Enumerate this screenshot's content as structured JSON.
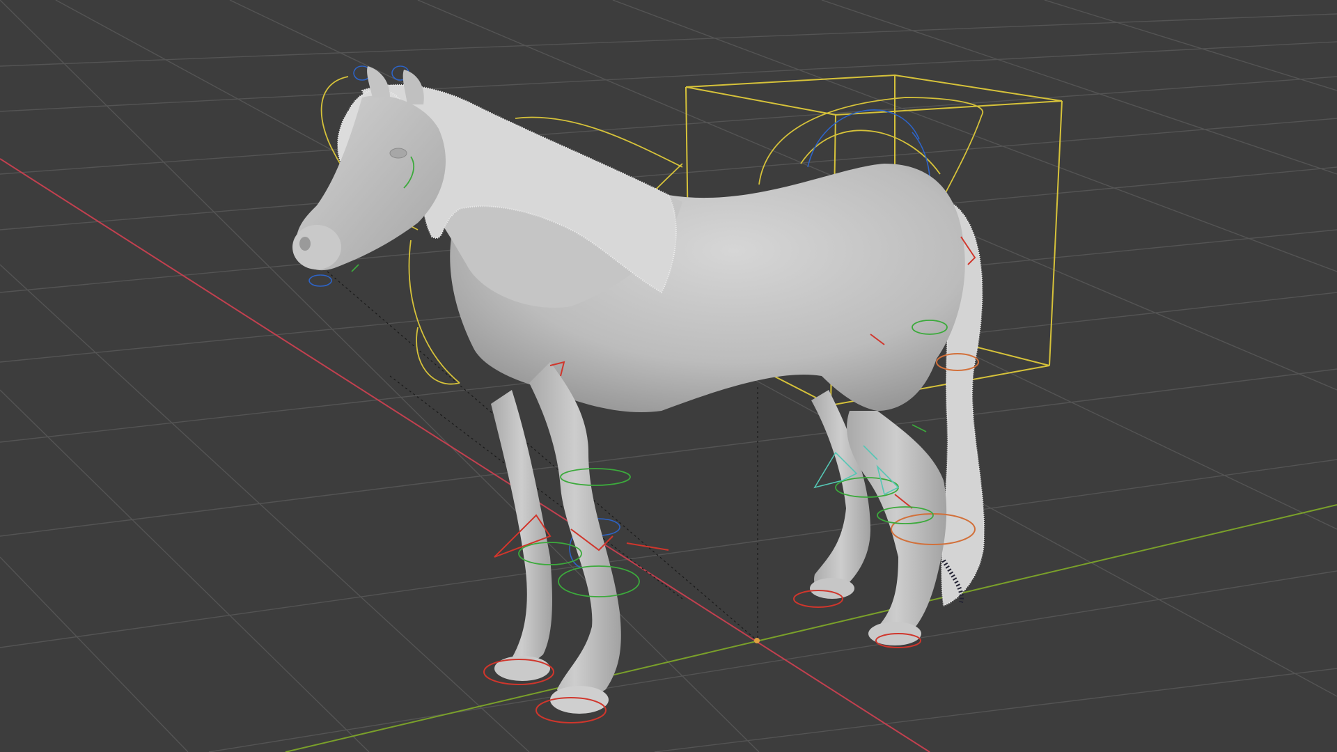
{
  "app": {
    "name": "3D viewport",
    "background": "#3d3d3d"
  },
  "scene": {
    "object": "horse",
    "shading": "solid",
    "overlays": {
      "grid_floor": true,
      "x_axis_color": "#c2404f",
      "y_axis_color": "#7aa02a",
      "grid_color": "#545454"
    },
    "helpers": {
      "bounding_box_color": "#d6c23a",
      "rig_curve_color": "#d6c23a",
      "control_colors": [
        "#d0362c",
        "#2d64c8",
        "#3caa3c",
        "#55c7b5"
      ]
    },
    "mesh_color": "#b9b9b9",
    "hair_color": "#d7d7d7"
  },
  "icons": {
    "origin": "origin-dot-icon"
  }
}
